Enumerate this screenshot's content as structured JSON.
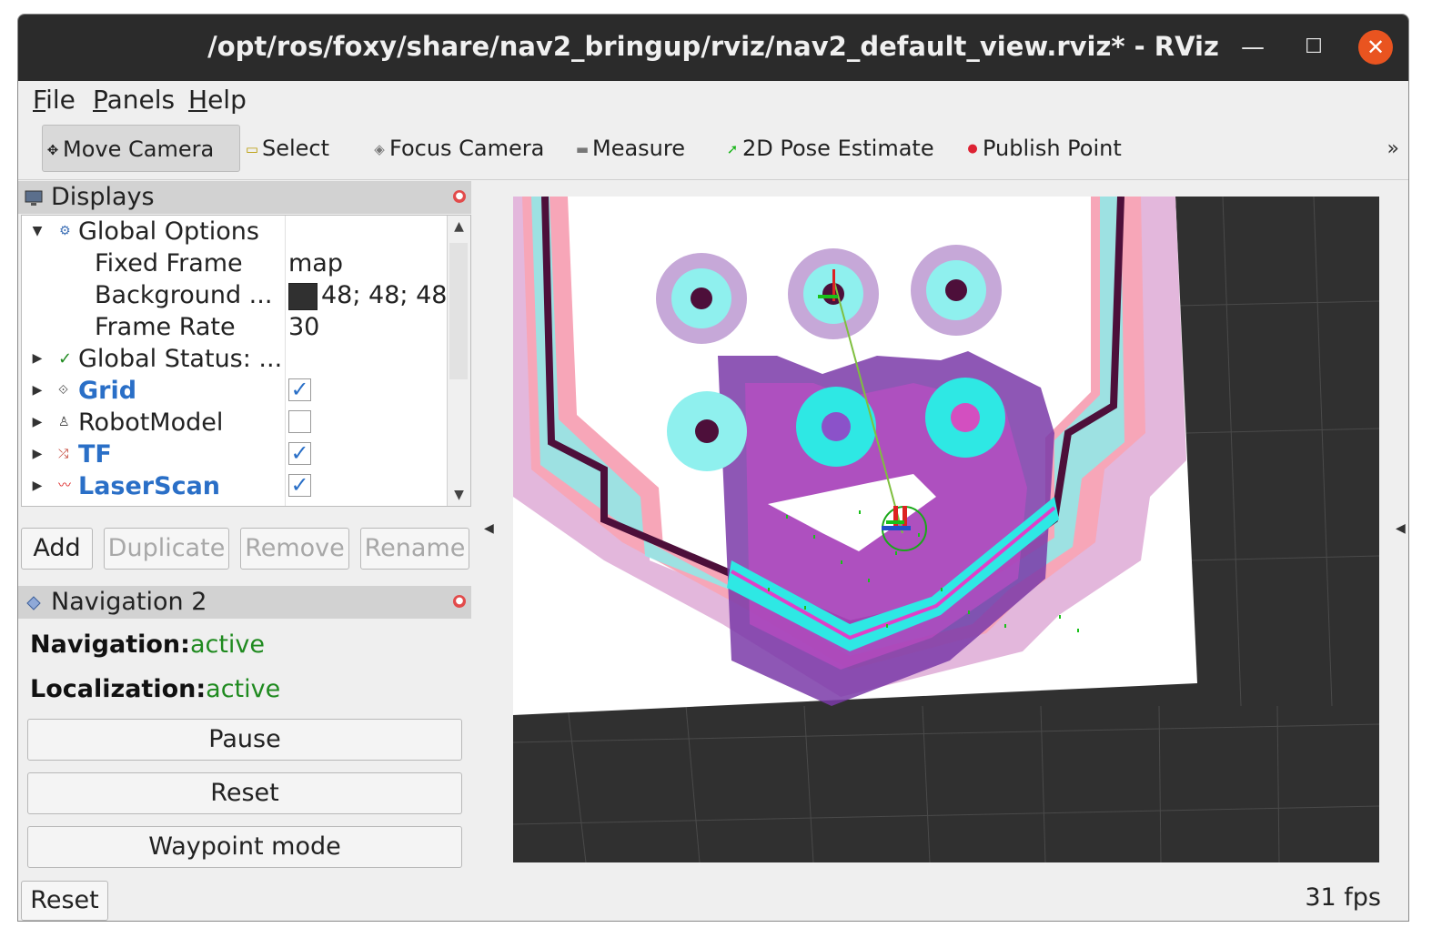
{
  "window": {
    "title": "/opt/ros/foxy/share/nav2_bringup/rviz/nav2_default_view.rviz* - RViz",
    "minimize_glyph": "—",
    "maximize_glyph": "☐",
    "close_glyph": "✕"
  },
  "menubar": {
    "items": [
      {
        "label": "File",
        "accel": "F",
        "rest": "ile"
      },
      {
        "label": "Panels",
        "accel": "P",
        "rest": "anels"
      },
      {
        "label": "Help",
        "accel": "H",
        "rest": "elp"
      }
    ]
  },
  "toolbar": {
    "tools": [
      {
        "label": "Move Camera",
        "icon": "move-camera-icon",
        "glyph": "✥",
        "active": true
      },
      {
        "label": "Select",
        "icon": "select-icon",
        "glyph": "▭",
        "active": false
      },
      {
        "label": "Focus Camera",
        "icon": "focus-camera-icon",
        "glyph": "◈",
        "active": false
      },
      {
        "label": "Measure",
        "icon": "measure-icon",
        "glyph": "▬",
        "active": false
      },
      {
        "label": "2D Pose Estimate",
        "icon": "pose-estimate-icon",
        "glyph": "➚",
        "active": false
      },
      {
        "label": "Publish Point",
        "icon": "publish-point-icon",
        "glyph": "📍",
        "active": false
      }
    ],
    "overflow": "»"
  },
  "displays_panel": {
    "title": "Displays",
    "rows": [
      {
        "label": "Global Options",
        "icon": "global-options-icon",
        "glyph": "⚙",
        "expanded": true
      },
      {
        "label": "Fixed Frame",
        "value": "map"
      },
      {
        "label": "Background ...",
        "value": "48; 48; 48",
        "swatch_color": "#303030"
      },
      {
        "label": "Frame Rate",
        "value": "30"
      },
      {
        "label": "Global Status: ...",
        "icon": "status-ok-icon",
        "glyph": "✓"
      },
      {
        "label": "Grid",
        "icon": "grid-icon",
        "glyph": "⟐",
        "checked": true
      },
      {
        "label": "RobotModel",
        "icon": "robot-model-icon",
        "glyph": "♙",
        "checked": false
      },
      {
        "label": "TF",
        "icon": "tf-icon",
        "glyph": "⤮",
        "checked": true
      },
      {
        "label": "LaserScan",
        "icon": "laser-scan-icon",
        "glyph": "〰",
        "checked": true
      }
    ],
    "buttons": {
      "add": "Add",
      "duplicate": "Duplicate",
      "remove": "Remove",
      "rename": "Rename"
    }
  },
  "nav2_panel": {
    "title": "Navigation 2",
    "navigation_label": "Navigation:",
    "navigation_value": "active",
    "localization_label": "Localization:",
    "localization_value": "active",
    "pause": "Pause",
    "reset": "Reset",
    "waypoint": "Waypoint mode"
  },
  "status_bar": {
    "reset": "Reset",
    "fps": "31 fps"
  },
  "colors": {
    "titlebar": "#2b2b2b",
    "close": "#e95420",
    "viewport_bg": "#303030",
    "active_status": "#1f8a1f",
    "enabled_display": "#2a6fc7"
  }
}
